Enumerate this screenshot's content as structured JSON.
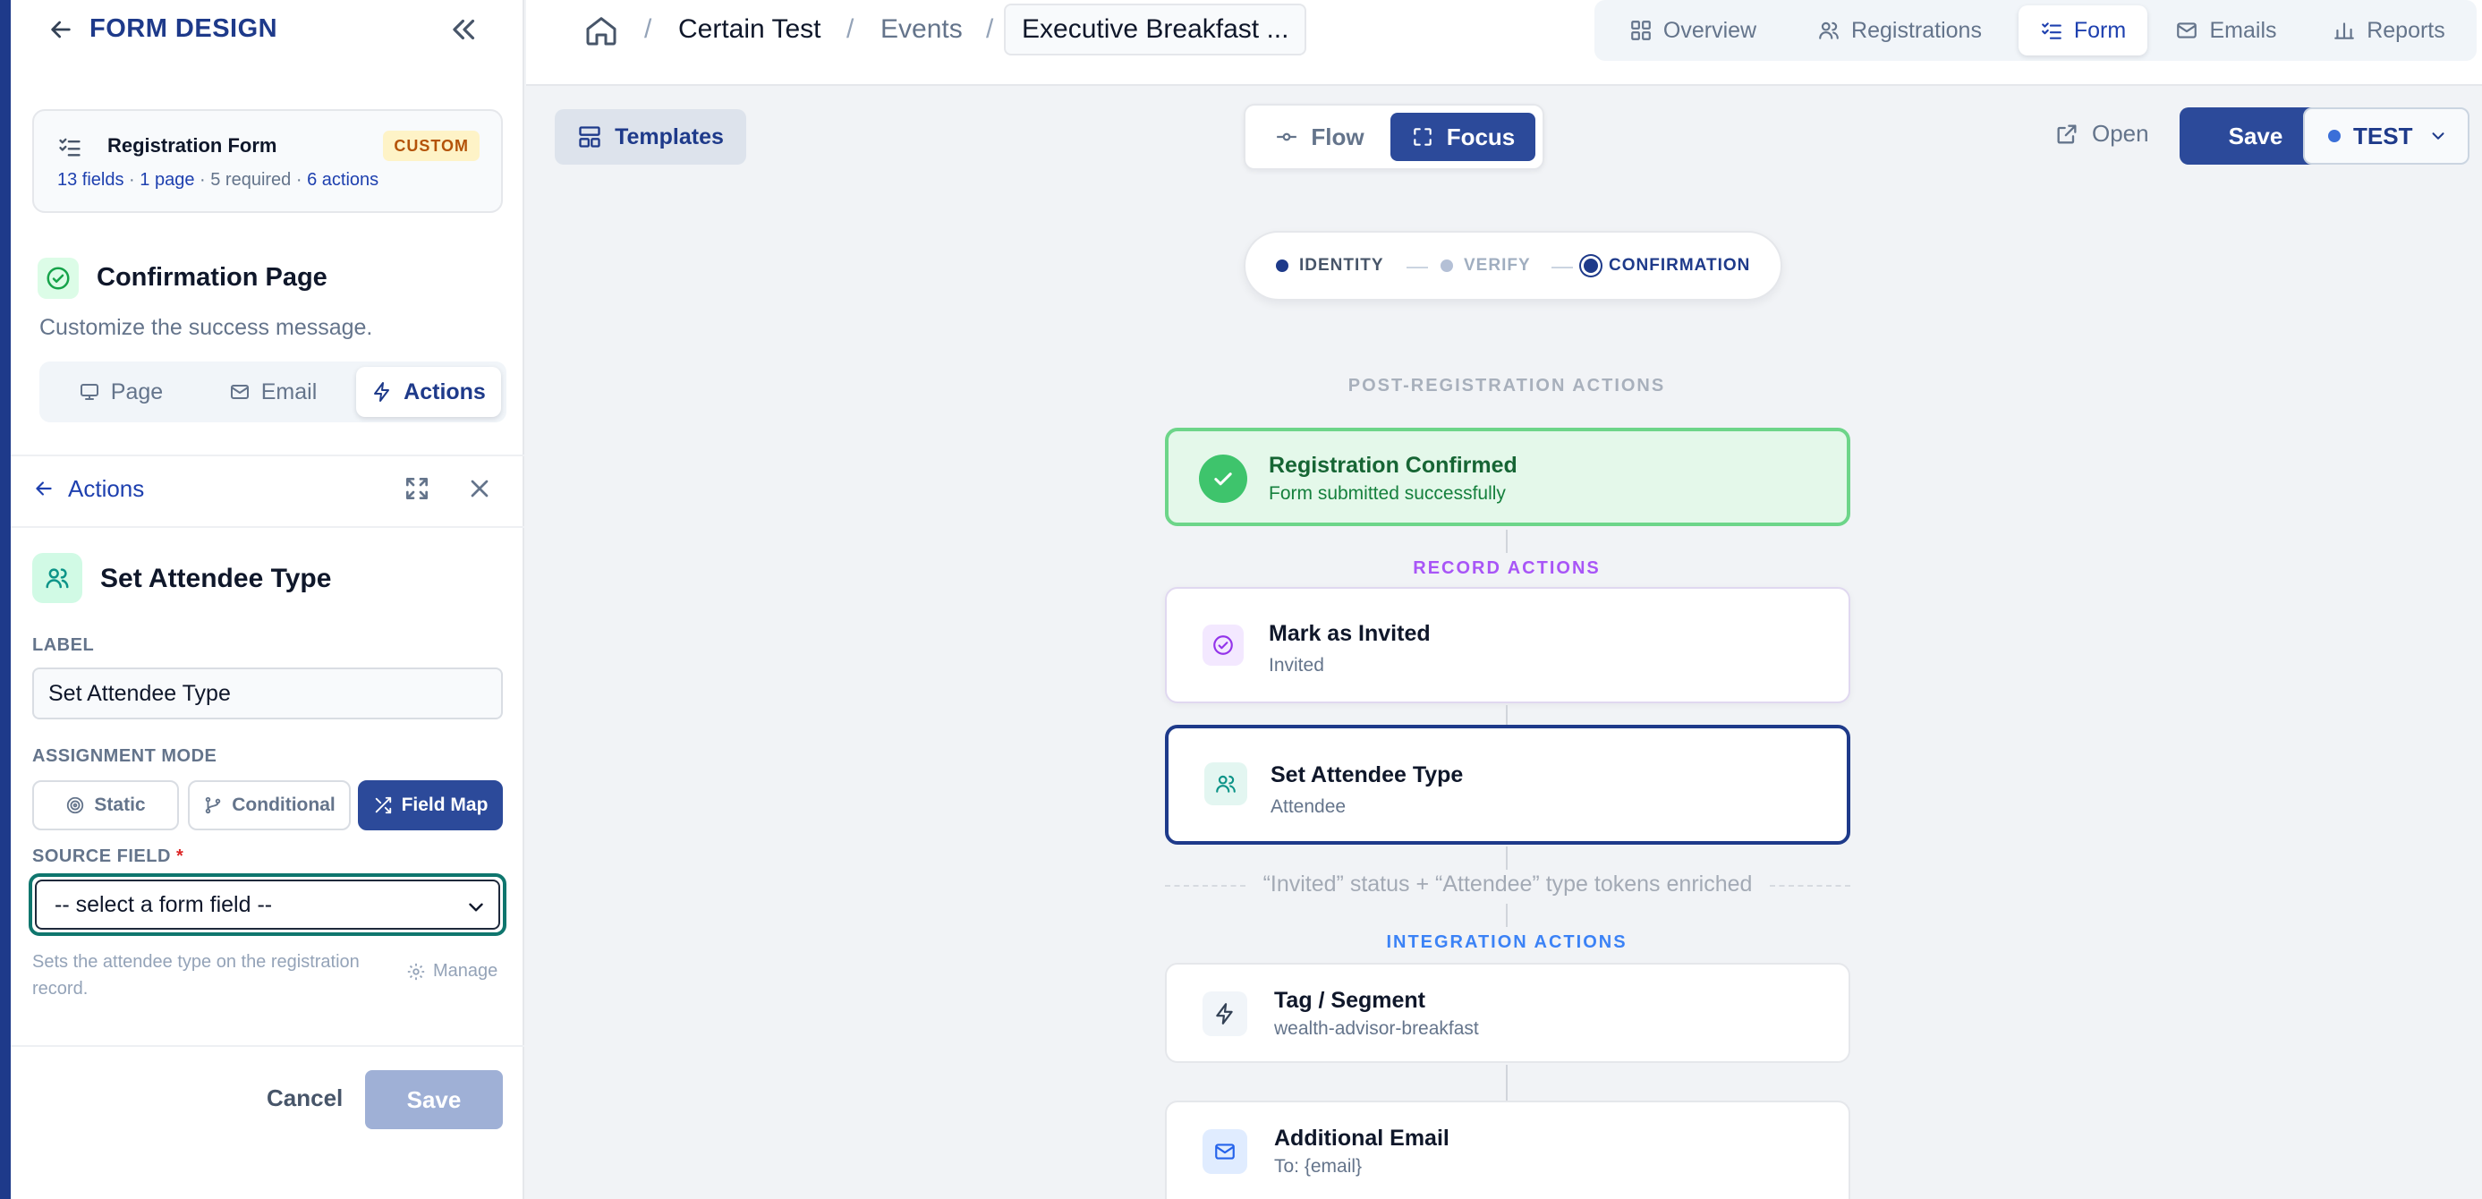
{
  "sidebar": {
    "title": "FORM DESIGN",
    "form_card": {
      "title": "Registration Form",
      "badge": "CUSTOM",
      "meta_fields": "13 fields",
      "meta_pages": "1 page",
      "meta_required": "5 required",
      "meta_actions": "6 actions",
      "sep": " · "
    },
    "section": {
      "title": "Confirmation Page",
      "subtitle": "Customize the success message."
    },
    "tabs": [
      {
        "label": "Page",
        "icon": "monitor-icon",
        "active": false
      },
      {
        "label": "Email",
        "icon": "mail-icon",
        "active": false
      },
      {
        "label": "Actions",
        "icon": "bolt-icon",
        "active": true
      }
    ],
    "actions_back": "Actions",
    "editor": {
      "title": "Set Attendee Type",
      "label_caption": "LABEL",
      "label_value": "Set Attendee Type",
      "mode_caption": "ASSIGNMENT MODE",
      "modes": [
        {
          "label": "Static",
          "icon": "target-icon",
          "active": false
        },
        {
          "label": "Conditional",
          "icon": "branch-icon",
          "active": false
        },
        {
          "label": "Field Map",
          "icon": "shuffle-icon",
          "active": true
        }
      ],
      "source_caption": "SOURCE FIELD",
      "required_mark": "*",
      "source_value": "-- select a form field --",
      "help_text": "Sets the attendee type on the registration record.",
      "manage_label": "Manage"
    },
    "footer": {
      "cancel": "Cancel",
      "save": "Save"
    }
  },
  "topbar": {
    "breadcrumbs": [
      "Certain Test",
      "Events",
      "Executive Breakfast ..."
    ],
    "separator": "/",
    "nav": [
      {
        "label": "Overview",
        "icon": "grid-icon",
        "active": false
      },
      {
        "label": "Registrations",
        "icon": "users-icon",
        "active": false
      },
      {
        "label": "Form",
        "icon": "checklist-icon",
        "active": true
      },
      {
        "label": "Emails",
        "icon": "mail-icon",
        "active": false
      },
      {
        "label": "Reports",
        "icon": "bar-chart-icon",
        "active": false
      }
    ]
  },
  "toolbar": {
    "templates": "Templates",
    "view_flow": "Flow",
    "view_focus": "Focus",
    "open": "Open",
    "save": "Save",
    "env": "TEST"
  },
  "stepper": {
    "steps": [
      {
        "label": "IDENTITY",
        "state": "done"
      },
      {
        "label": "VERIFY",
        "state": "pending"
      },
      {
        "label": "CONFIRMATION",
        "state": "current"
      }
    ]
  },
  "flow": {
    "post_label": "POST-REGISTRATION ACTIONS",
    "confirmed": {
      "title": "Registration Confirmed",
      "subtitle": "Form submitted successfully"
    },
    "record_label": "RECORD ACTIONS",
    "invited": {
      "title": "Mark as Invited",
      "subtitle": "Invited"
    },
    "attendee_type": {
      "title": "Set Attendee Type",
      "subtitle": "Attendee"
    },
    "enrich_note": "“Invited” status + “Attendee” type tokens enriched",
    "integration_label": "INTEGRATION ACTIONS",
    "tag": {
      "title": "Tag / Segment",
      "subtitle": "wealth-advisor-breakfast"
    },
    "email": {
      "title": "Additional Email",
      "subtitle": "To: {email}"
    }
  },
  "colors": {
    "brand": "#1e3a8a",
    "primary_button": "#2c4a9a",
    "success": "#3ec46c",
    "record_accent": "#a855f7",
    "integration_accent": "#3b82f6",
    "badge_custom": "#b45309"
  }
}
